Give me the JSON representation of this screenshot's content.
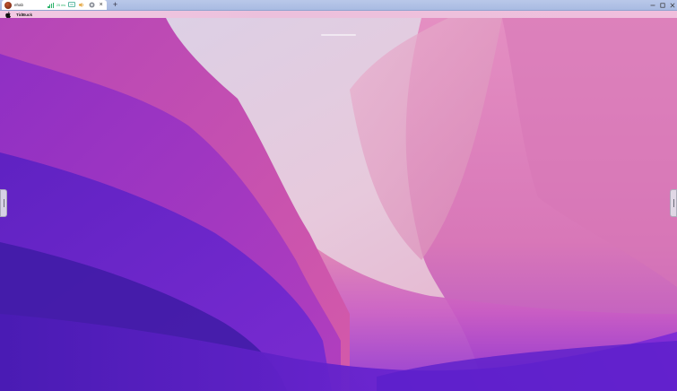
{
  "session_tab": {
    "name": "ehab",
    "latency": "25 ms",
    "close_label": "×"
  },
  "new_tab_label": "+",
  "menubar": {
    "app_name": "TidBuck"
  },
  "colors": {
    "signal": "#2db36b",
    "tabbar": "#b0c1e6",
    "menubar": "#efc4df"
  },
  "icons": {
    "avatar": "avatar",
    "signal": "signal-strength-icon",
    "display": "display-icon",
    "audio": "speaker-icon",
    "settings": "gear-icon",
    "close": "close-icon",
    "minimize": "minimize-icon",
    "maximize": "maximize-icon",
    "window_close": "window-close-icon",
    "apple": "apple-logo-icon"
  }
}
